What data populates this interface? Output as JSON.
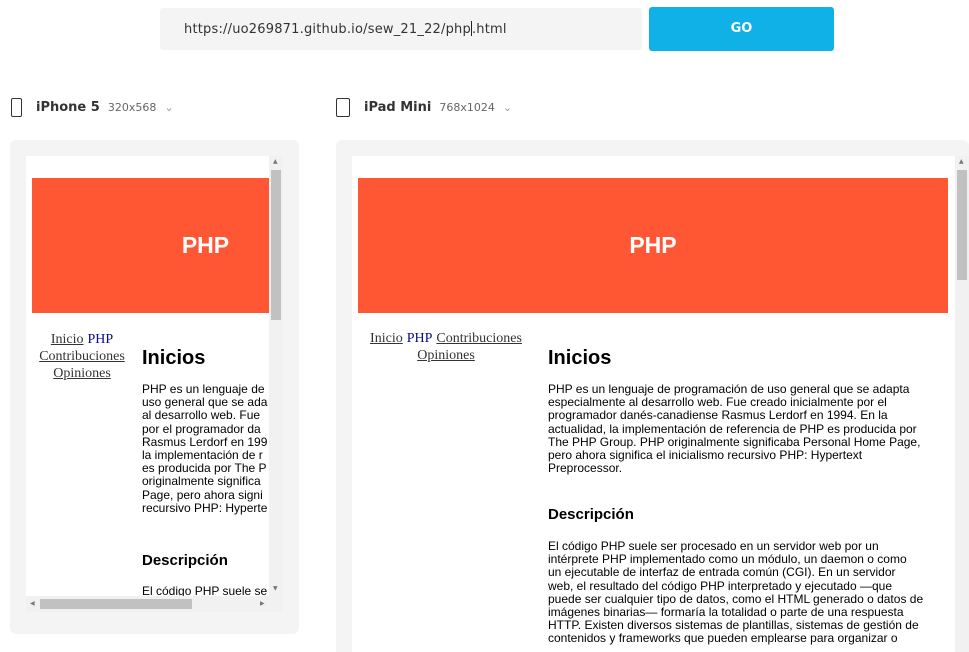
{
  "toolbar": {
    "url_before_caret": "https://uo269871.github.io/sew_21_22/php",
    "url_after_caret": ".html",
    "go_label": "GO"
  },
  "devices": [
    {
      "name": "iPhone 5",
      "size": "320x568",
      "chevron": "⌄",
      "icon": "phone-icon"
    },
    {
      "name": "iPad Mini",
      "size": "768x1024",
      "chevron": "⌄",
      "icon": "tablet-icon"
    }
  ],
  "site": {
    "header_title": "PHP",
    "nav": [
      "Inicio",
      "PHP",
      "Contribuciones",
      "Opiniones"
    ],
    "heading_intro": "Inicios",
    "heading_desc": "Descripción",
    "phone_par1_lines": [
      "PHP es un lenguaje de",
      "uso general que se ada",
      "al desarrollo web. Fue",
      "por el programador da",
      "Rasmus Lerdorf en 199",
      "la implementación de r",
      "es producida por The P",
      "originalmente significa",
      "Page, pero ahora signi",
      "recursivo PHP: Hyperte"
    ],
    "phone_par2_first_line": "El código PHP suele se",
    "tablet_par1_lines": [
      "PHP es un lenguaje de programación de uso general que se adapta",
      "especialmente al desarrollo web. Fue creado inicialmente por el",
      "programador danés-canadiense Rasmus Lerdorf en 1994. En la",
      "actualidad, la implementación de referencia de PHP es producida por",
      "The PHP Group. PHP originalmente significaba Personal Home Page,",
      "pero ahora significa el inicialismo recursivo PHP: Hypertext",
      "Preprocessor."
    ],
    "tablet_par2_lines": [
      "El código PHP suele ser procesado en un servidor web por un",
      "intérprete PHP implementado como un módulo, un daemon o como",
      "un ejecutable de interfaz de entrada común (CGI). En un servidor",
      "web, el resultado del código PHP interpretado y ejecutado —que",
      "puede ser cualquier tipo de datos, como el HTML generado o datos de",
      "imágenes binarias— formaría la totalidad o parte de una respuesta",
      "HTTP. Existen diversos sistemas de plantillas, sistemas de gestión de",
      "contenidos y frameworks que pueden emplearse para organizar o"
    ]
  },
  "colors": {
    "accent": "#0fb1e6",
    "header_bg": "#ff5733",
    "frame_bg": "#f4f4f5"
  }
}
